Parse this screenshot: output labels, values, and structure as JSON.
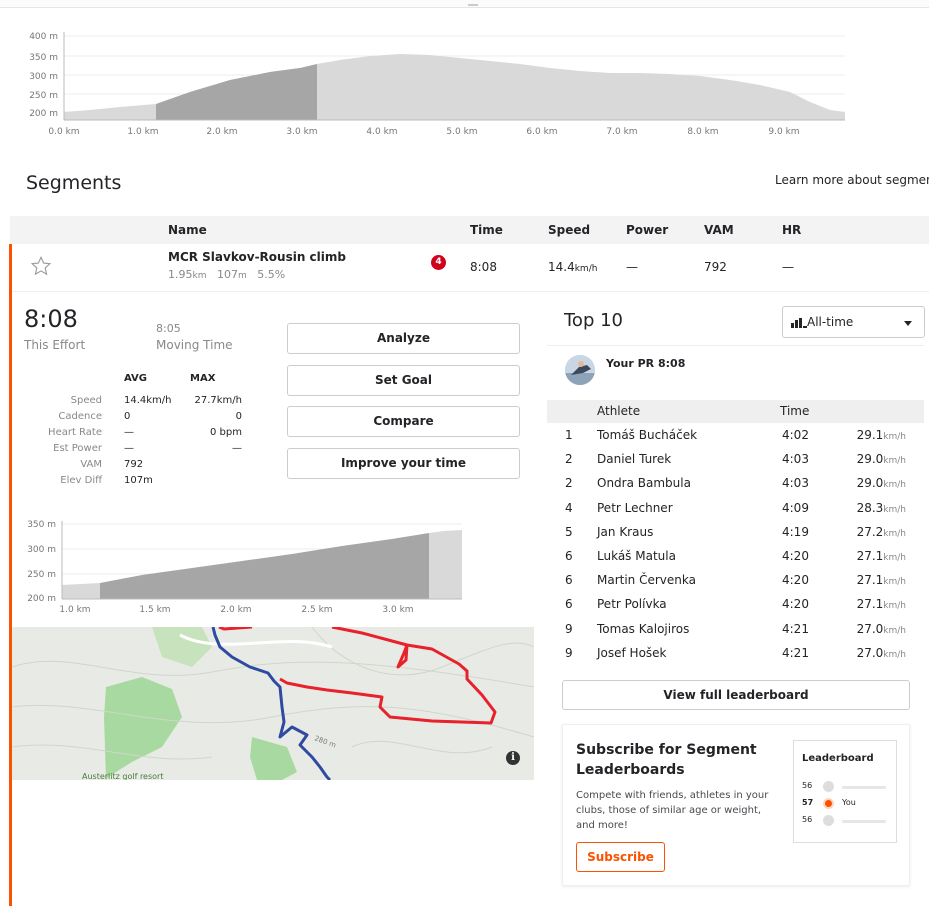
{
  "elevation_chart": {
    "y_ticks": [
      "400 m",
      "350 m",
      "300 m",
      "250 m",
      "200 m"
    ],
    "x_ticks": [
      "0.0 km",
      "1.0 km",
      "2.0 km",
      "3.0 km",
      "4.0 km",
      "5.0 km",
      "6.0 km",
      "7.0 km",
      "8.0 km",
      "9.0 km"
    ]
  },
  "segments": {
    "title": "Segments",
    "learn_more": "Learn more about segment",
    "columns": {
      "name": "Name",
      "time": "Time",
      "speed": "Speed",
      "power": "Power",
      "vam": "VAM",
      "hr": "HR"
    },
    "row": {
      "name": "MCR Slavkov-Rousin climb",
      "distance": "1.95",
      "distance_unit": "km",
      "elevation": "107",
      "elevation_unit": "m",
      "grade": "5.5%",
      "badge": "4",
      "time": "8:08",
      "speed": "14.4",
      "speed_unit": "km/h",
      "power": "—",
      "vam": "792",
      "hr": "—"
    }
  },
  "effort": {
    "time": "8:08",
    "time_label": "This Effort",
    "moving_time": "8:05",
    "moving_label": "Moving Time",
    "stats_headers": {
      "avg": "AVG",
      "max": "MAX"
    },
    "stats": [
      {
        "label": "Speed",
        "avg": "14.4km/h",
        "max": "27.7km/h"
      },
      {
        "label": "Cadence",
        "avg": "0",
        "max": "0"
      },
      {
        "label": "Heart Rate",
        "avg": "—",
        "max": "0 bpm"
      },
      {
        "label": "Est Power",
        "avg": "—",
        "max": "—"
      },
      {
        "label": "VAM",
        "avg": "792",
        "max": ""
      },
      {
        "label": "Elev Diff",
        "avg": "107m",
        "max": ""
      }
    ],
    "buttons": {
      "analyze": "Analyze",
      "set_goal": "Set Goal",
      "compare": "Compare",
      "improve": "Improve your time"
    }
  },
  "mini_chart": {
    "y_ticks": [
      "350 m",
      "300 m",
      "250 m",
      "200 m"
    ],
    "x_ticks": [
      "1.0 km",
      "1.5 km",
      "2.0 km",
      "2.5 km",
      "3.0 km"
    ]
  },
  "map": {
    "label_golf": "Austerlitz golf resort",
    "label_contour": "280 m",
    "info": "i"
  },
  "top10": {
    "title": "Top 10",
    "filter": "All-time",
    "pr_label": "Your PR",
    "pr_time": "8:08",
    "columns": {
      "athlete": "Athlete",
      "time": "Time"
    },
    "rows": [
      {
        "rank": "1",
        "name": "Tomáš Bucháček",
        "time": "4:02",
        "speed": "29.1",
        "unit": "km/h"
      },
      {
        "rank": "2",
        "name": "Daniel Turek",
        "time": "4:03",
        "speed": "29.0",
        "unit": "km/h"
      },
      {
        "rank": "2",
        "name": "Ondra Bambula",
        "time": "4:03",
        "speed": "29.0",
        "unit": "km/h"
      },
      {
        "rank": "4",
        "name": "Petr Lechner",
        "time": "4:09",
        "speed": "28.3",
        "unit": "km/h"
      },
      {
        "rank": "5",
        "name": "Jan Kraus",
        "time": "4:19",
        "speed": "27.2",
        "unit": "km/h"
      },
      {
        "rank": "6",
        "name": "Lukáš Matula",
        "time": "4:20",
        "speed": "27.1",
        "unit": "km/h"
      },
      {
        "rank": "6",
        "name": "Martin Červenka",
        "time": "4:20",
        "speed": "27.1",
        "unit": "km/h"
      },
      {
        "rank": "6",
        "name": "Petr Polívka",
        "time": "4:20",
        "speed": "27.1",
        "unit": "km/h"
      },
      {
        "rank": "9",
        "name": "Tomas Kalojiros",
        "time": "4:21",
        "speed": "27.0",
        "unit": "km/h"
      },
      {
        "rank": "9",
        "name": "Josef Hošek",
        "time": "4:21",
        "speed": "27.0",
        "unit": "km/h"
      }
    ],
    "view_full": "View full leaderboard"
  },
  "subscribe": {
    "title": "Subscribe for Segment Leaderboards",
    "description": "Compete with friends, athletes in your clubs, those of similar age or weight, and more!",
    "button": "Subscribe",
    "mini_title": "Leaderboard",
    "mini_rows": [
      {
        "rank": "56",
        "you": ""
      },
      {
        "rank": "57",
        "you": "You"
      },
      {
        "rank": "56",
        "you": ""
      }
    ]
  },
  "colors": {
    "accent": "#fc5200",
    "badge": "#d0021b",
    "route_red": "#e8212b",
    "route_blue": "#2f4aa0"
  }
}
